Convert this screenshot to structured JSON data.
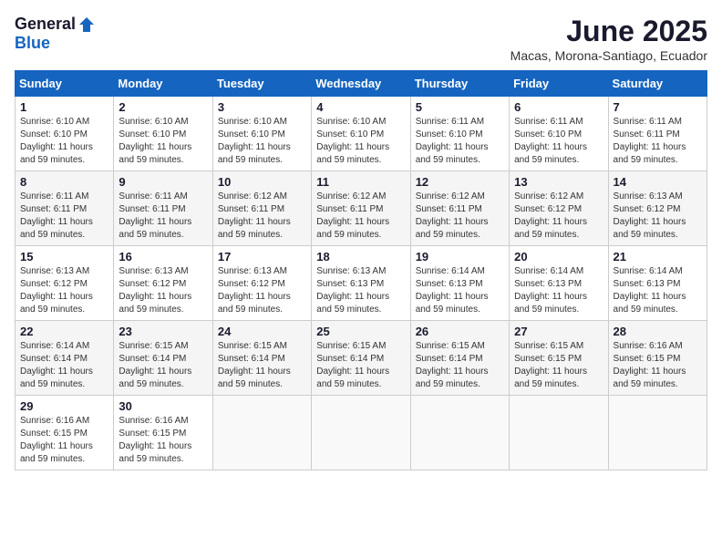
{
  "logo": {
    "general": "General",
    "blue": "Blue"
  },
  "title": "June 2025",
  "location": "Macas, Morona-Santiago, Ecuador",
  "headers": [
    "Sunday",
    "Monday",
    "Tuesday",
    "Wednesday",
    "Thursday",
    "Friday",
    "Saturday"
  ],
  "weeks": [
    [
      {
        "day": "1",
        "sunrise": "6:10 AM",
        "sunset": "6:10 PM",
        "daylight": "11 hours and 59 minutes."
      },
      {
        "day": "2",
        "sunrise": "6:10 AM",
        "sunset": "6:10 PM",
        "daylight": "11 hours and 59 minutes."
      },
      {
        "day": "3",
        "sunrise": "6:10 AM",
        "sunset": "6:10 PM",
        "daylight": "11 hours and 59 minutes."
      },
      {
        "day": "4",
        "sunrise": "6:10 AM",
        "sunset": "6:10 PM",
        "daylight": "11 hours and 59 minutes."
      },
      {
        "day": "5",
        "sunrise": "6:11 AM",
        "sunset": "6:10 PM",
        "daylight": "11 hours and 59 minutes."
      },
      {
        "day": "6",
        "sunrise": "6:11 AM",
        "sunset": "6:10 PM",
        "daylight": "11 hours and 59 minutes."
      },
      {
        "day": "7",
        "sunrise": "6:11 AM",
        "sunset": "6:11 PM",
        "daylight": "11 hours and 59 minutes."
      }
    ],
    [
      {
        "day": "8",
        "sunrise": "6:11 AM",
        "sunset": "6:11 PM",
        "daylight": "11 hours and 59 minutes."
      },
      {
        "day": "9",
        "sunrise": "6:11 AM",
        "sunset": "6:11 PM",
        "daylight": "11 hours and 59 minutes."
      },
      {
        "day": "10",
        "sunrise": "6:12 AM",
        "sunset": "6:11 PM",
        "daylight": "11 hours and 59 minutes."
      },
      {
        "day": "11",
        "sunrise": "6:12 AM",
        "sunset": "6:11 PM",
        "daylight": "11 hours and 59 minutes."
      },
      {
        "day": "12",
        "sunrise": "6:12 AM",
        "sunset": "6:11 PM",
        "daylight": "11 hours and 59 minutes."
      },
      {
        "day": "13",
        "sunrise": "6:12 AM",
        "sunset": "6:12 PM",
        "daylight": "11 hours and 59 minutes."
      },
      {
        "day": "14",
        "sunrise": "6:13 AM",
        "sunset": "6:12 PM",
        "daylight": "11 hours and 59 minutes."
      }
    ],
    [
      {
        "day": "15",
        "sunrise": "6:13 AM",
        "sunset": "6:12 PM",
        "daylight": "11 hours and 59 minutes."
      },
      {
        "day": "16",
        "sunrise": "6:13 AM",
        "sunset": "6:12 PM",
        "daylight": "11 hours and 59 minutes."
      },
      {
        "day": "17",
        "sunrise": "6:13 AM",
        "sunset": "6:12 PM",
        "daylight": "11 hours and 59 minutes."
      },
      {
        "day": "18",
        "sunrise": "6:13 AM",
        "sunset": "6:13 PM",
        "daylight": "11 hours and 59 minutes."
      },
      {
        "day": "19",
        "sunrise": "6:14 AM",
        "sunset": "6:13 PM",
        "daylight": "11 hours and 59 minutes."
      },
      {
        "day": "20",
        "sunrise": "6:14 AM",
        "sunset": "6:13 PM",
        "daylight": "11 hours and 59 minutes."
      },
      {
        "day": "21",
        "sunrise": "6:14 AM",
        "sunset": "6:13 PM",
        "daylight": "11 hours and 59 minutes."
      }
    ],
    [
      {
        "day": "22",
        "sunrise": "6:14 AM",
        "sunset": "6:14 PM",
        "daylight": "11 hours and 59 minutes."
      },
      {
        "day": "23",
        "sunrise": "6:15 AM",
        "sunset": "6:14 PM",
        "daylight": "11 hours and 59 minutes."
      },
      {
        "day": "24",
        "sunrise": "6:15 AM",
        "sunset": "6:14 PM",
        "daylight": "11 hours and 59 minutes."
      },
      {
        "day": "25",
        "sunrise": "6:15 AM",
        "sunset": "6:14 PM",
        "daylight": "11 hours and 59 minutes."
      },
      {
        "day": "26",
        "sunrise": "6:15 AM",
        "sunset": "6:14 PM",
        "daylight": "11 hours and 59 minutes."
      },
      {
        "day": "27",
        "sunrise": "6:15 AM",
        "sunset": "6:15 PM",
        "daylight": "11 hours and 59 minutes."
      },
      {
        "day": "28",
        "sunrise": "6:16 AM",
        "sunset": "6:15 PM",
        "daylight": "11 hours and 59 minutes."
      }
    ],
    [
      {
        "day": "29",
        "sunrise": "6:16 AM",
        "sunset": "6:15 PM",
        "daylight": "11 hours and 59 minutes."
      },
      {
        "day": "30",
        "sunrise": "6:16 AM",
        "sunset": "6:15 PM",
        "daylight": "11 hours and 59 minutes."
      },
      null,
      null,
      null,
      null,
      null
    ]
  ]
}
